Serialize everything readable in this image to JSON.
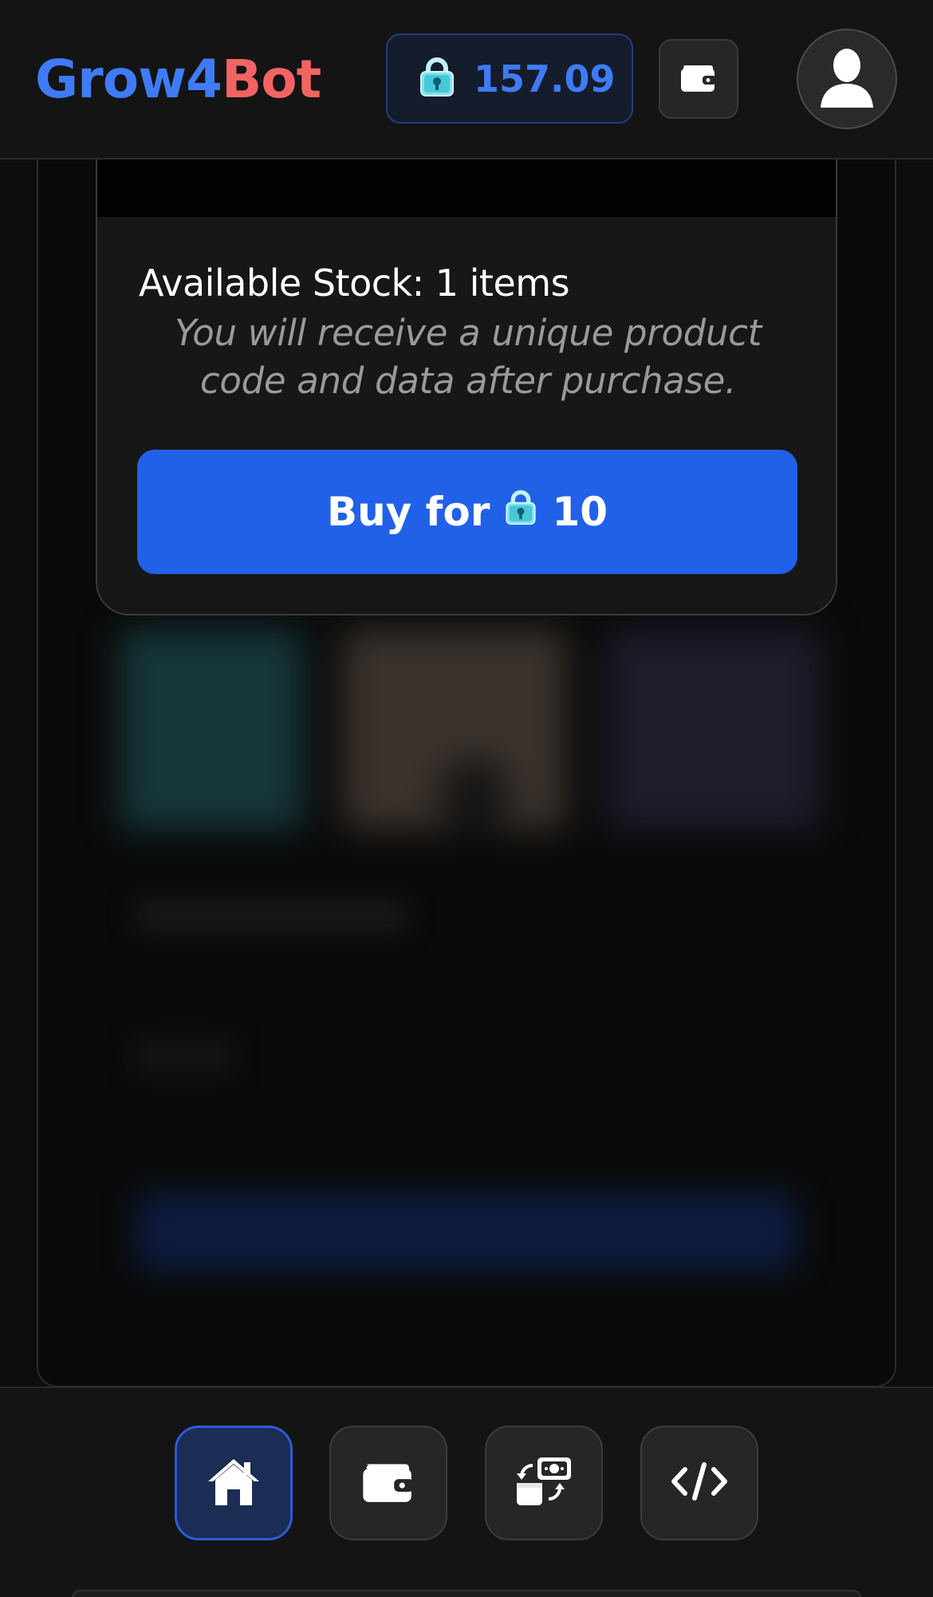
{
  "header": {
    "logo_part1": "Grow4",
    "logo_part2": "Bot",
    "balance": "157.09",
    "balance_icon": "lock-gem-icon",
    "wallet_icon": "wallet-icon",
    "avatar_icon": "user-avatar-icon"
  },
  "purchase_card": {
    "stock_text": "Available Stock: 1 items",
    "note_text": "You will receive a unique product code and data after purchase.",
    "buy_label": "Buy for",
    "buy_price": "10",
    "price_icon": "lock-gem-icon"
  },
  "bottom_nav": {
    "items": [
      {
        "name": "home",
        "icon": "home-icon",
        "active": true
      },
      {
        "name": "wallet",
        "icon": "wallet-icon",
        "active": false
      },
      {
        "name": "exchange",
        "icon": "exchange-icon",
        "active": false
      },
      {
        "name": "code",
        "icon": "code-icon",
        "active": false
      }
    ]
  },
  "colors": {
    "accent_blue": "#2161e7",
    "logo_blue": "#3f7bf5",
    "logo_red": "#f26464",
    "background": "#0d0d0e"
  }
}
